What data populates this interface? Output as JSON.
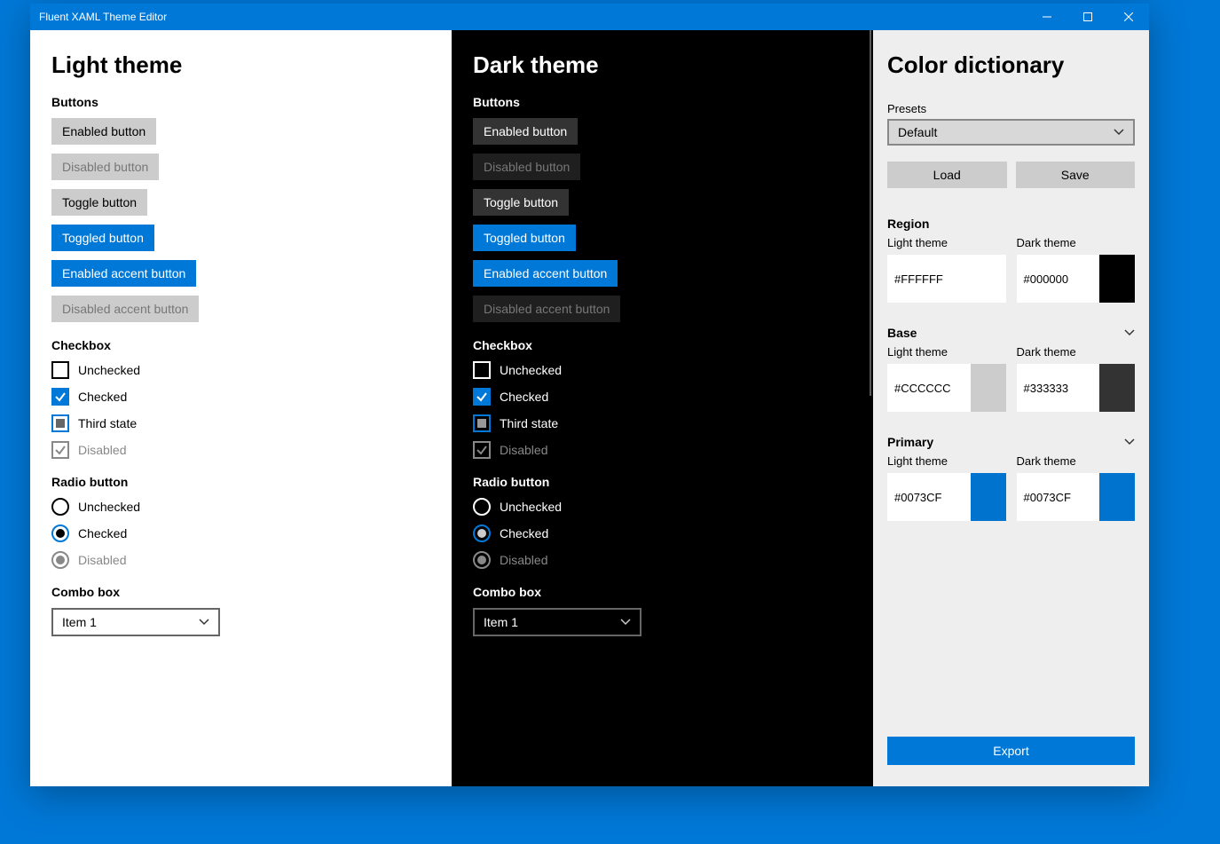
{
  "title": "Fluent XAML Theme Editor",
  "light": {
    "heading": "Light theme",
    "sections": {
      "buttons": "Buttons",
      "checkbox": "Checkbox",
      "radio": "Radio button",
      "combo": "Combo box"
    },
    "buttons": {
      "enabled": "Enabled button",
      "disabled": "Disabled button",
      "toggle": "Toggle button",
      "toggled": "Toggled button",
      "accent": "Enabled accent button",
      "accentDisabled": "Disabled accent button"
    },
    "checkbox": {
      "unchecked": "Unchecked",
      "checked": "Checked",
      "third": "Third state",
      "disabled": "Disabled"
    },
    "radio": {
      "unchecked": "Unchecked",
      "checked": "Checked",
      "disabled": "Disabled"
    },
    "combo": {
      "value": "Item 1"
    }
  },
  "dark": {
    "heading": "Dark theme",
    "sections": {
      "buttons": "Buttons",
      "checkbox": "Checkbox",
      "radio": "Radio button",
      "combo": "Combo box"
    },
    "buttons": {
      "enabled": "Enabled button",
      "disabled": "Disabled button",
      "toggle": "Toggle button",
      "toggled": "Toggled button",
      "accent": "Enabled accent button",
      "accentDisabled": "Disabled accent button"
    },
    "checkbox": {
      "unchecked": "Unchecked",
      "checked": "Checked",
      "third": "Third state",
      "disabled": "Disabled"
    },
    "radio": {
      "unchecked": "Unchecked",
      "checked": "Checked",
      "disabled": "Disabled"
    },
    "combo": {
      "value": "Item 1"
    }
  },
  "side": {
    "heading": "Color dictionary",
    "presetsLabel": "Presets",
    "presetValue": "Default",
    "load": "Load",
    "save": "Save",
    "sections": {
      "region": "Region",
      "base": "Base",
      "primary": "Primary"
    },
    "lightLabel": "Light theme",
    "darkLabel": "Dark theme",
    "region": {
      "light": "#FFFFFF",
      "dark": "#000000"
    },
    "base": {
      "light": "#CCCCCC",
      "dark": "#333333"
    },
    "primary": {
      "light": "#0073CF",
      "dark": "#0073CF"
    },
    "export": "Export"
  }
}
